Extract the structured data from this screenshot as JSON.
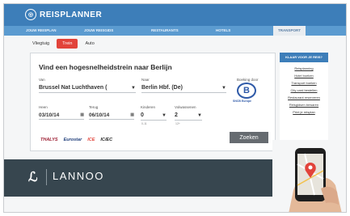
{
  "app": {
    "logo_text": "REISPLANNER"
  },
  "nav": {
    "items": [
      "JOUW REISPLAN",
      "JOUW REISGIDS",
      "RESTAURANTS",
      "HOTELS",
      "TRANSPORT"
    ],
    "active": "TRANSPORT"
  },
  "tabs": [
    {
      "label": "Vliegtuig",
      "active": false
    },
    {
      "label": "Trein",
      "active": true
    },
    {
      "label": "Auto",
      "active": false
    }
  ],
  "form": {
    "title": "Vind een hogesnelheidstrein naar Berlijn",
    "from_label": "Van",
    "from_value": "Brussel Nat Luchthaven (",
    "to_label": "Naar",
    "to_value": "Berlin Hbf. (De)",
    "booking_label": "Boeking door",
    "booking_brand": "SNCB",
    "booking_brand_sub": "Europe",
    "departure_label": "Heen",
    "departure_value": "03/10/14",
    "return_label": "Terug",
    "return_value": "06/10/14",
    "children_label": "Kinderen",
    "children_value": "0",
    "children_note": "0-11",
    "adults_label": "Volwassenen",
    "adults_value": "2",
    "adults_note": "12+",
    "submit_label": "Zoeken"
  },
  "brands": [
    "THALYS",
    "Eurostar",
    "ICE",
    "IC/EC"
  ],
  "sidebar": {
    "title": "KLAAR VOOR JE REIS?",
    "links": [
      "Reisplanning",
      "Hotel boeken",
      "Transport boeken",
      "City card bestellen",
      "Restaurant reserveren",
      "Reisgidsen bewaren",
      "Print je reisplan"
    ]
  },
  "footer": {
    "brand": "LANNOO"
  },
  "colors": {
    "primary": "#3d7eb9",
    "accent": "#e2433a",
    "footer": "#37464f"
  }
}
